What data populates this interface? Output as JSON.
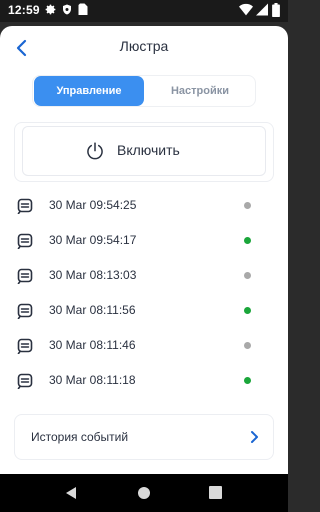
{
  "status_bar": {
    "time": "12:59"
  },
  "header": {
    "title": "Люстра"
  },
  "tabs": [
    {
      "label": "Управление",
      "active": true
    },
    {
      "label": "Настройки",
      "active": false
    }
  ],
  "power": {
    "label": "Включить"
  },
  "events": [
    {
      "time": "30 Mar 09:54:25",
      "status": "grey"
    },
    {
      "time": "30 Mar 09:54:17",
      "status": "green"
    },
    {
      "time": "30 Mar 08:13:03",
      "status": "grey"
    },
    {
      "time": "30 Mar 08:11:56",
      "status": "green"
    },
    {
      "time": "30 Mar 08:11:46",
      "status": "grey"
    },
    {
      "time": "30 Mar 08:11:18",
      "status": "green"
    }
  ],
  "history": {
    "label": "История событий"
  },
  "colors": {
    "accent": "#3b8ff0",
    "back": "#1b66d2",
    "green": "#1aa63a",
    "grey": "#a9a9a9"
  },
  "icons": [
    "settings-icon",
    "shield-icon",
    "sim-card-icon",
    "wifi-icon",
    "signal-icon",
    "battery-icon",
    "back-arrow-icon",
    "power-icon",
    "message-icon",
    "chevron-right-icon"
  ]
}
